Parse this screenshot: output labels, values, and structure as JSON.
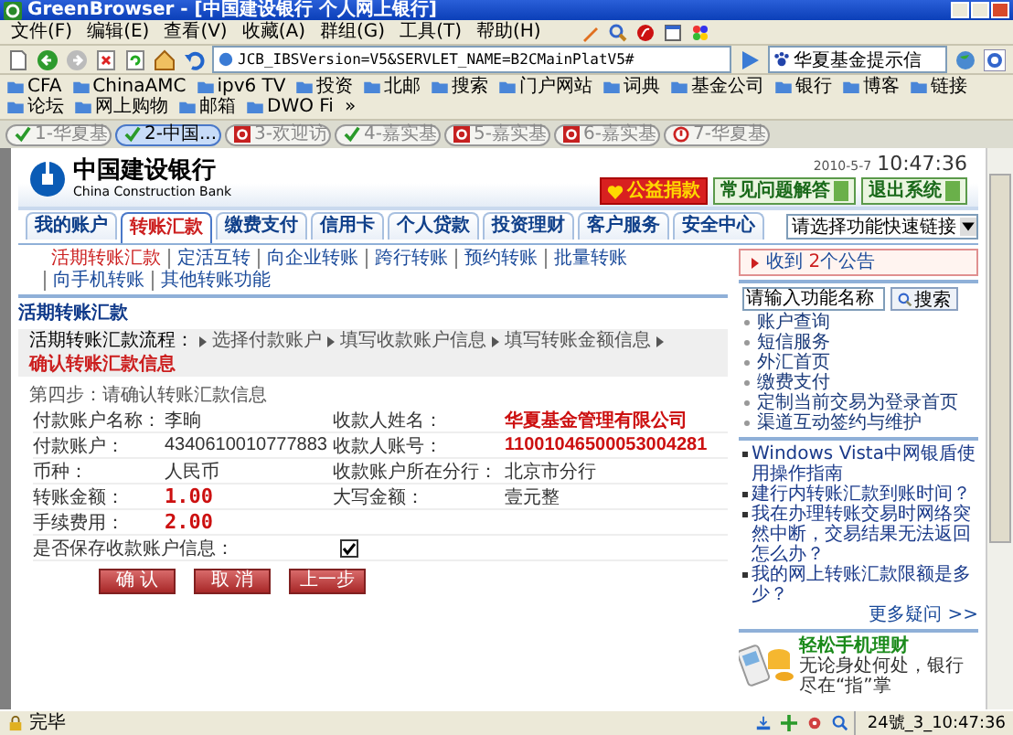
{
  "window": {
    "title": "GreenBrowser - [中国建设银行 个人网上银行]"
  },
  "menu": [
    "文件(F)",
    "编辑(E)",
    "查看(V)",
    "收藏(A)",
    "群组(G)",
    "工具(T)",
    "帮助(H)"
  ],
  "address_bar": {
    "value": "JCB_IBSVersion=V5&SERVLET_NAME=B2CMainPlatV5#"
  },
  "search_box": {
    "value": "华夏基金提示信"
  },
  "bookmarks": [
    "CFA",
    "ChinaAMC",
    "ipv6 TV",
    "投资",
    "北邮",
    "搜索",
    "门户网站",
    "词典",
    "基金公司",
    "银行",
    "博客",
    "链接",
    "论坛",
    "网上购物",
    "邮箱",
    "DWO Fi"
  ],
  "bookmarks_more": "»",
  "browser_tabs": [
    {
      "label": "1-华夏基",
      "kind": "ok",
      "selected": false
    },
    {
      "label": "2-中国...",
      "kind": "ok",
      "selected": true
    },
    {
      "label": "3-欢迎访",
      "kind": "site",
      "selected": false
    },
    {
      "label": "4-嘉实基",
      "kind": "ok",
      "selected": false
    },
    {
      "label": "5-嘉实基",
      "kind": "site",
      "selected": false
    },
    {
      "label": "6-嘉实基",
      "kind": "site",
      "selected": false
    },
    {
      "label": "7-华夏基",
      "kind": "alert",
      "selected": false
    }
  ],
  "page": {
    "logo": {
      "name_cn": "中国建设银行",
      "name_en": "China Construction Bank"
    },
    "date": "2010-5-7",
    "time": "10:47:36",
    "header_buttons": [
      {
        "label": "公益捐款",
        "kind": "donate"
      },
      {
        "label": "常见问题解答",
        "kind": "help"
      },
      {
        "label": "退出系统",
        "kind": "exit"
      }
    ],
    "nav_tabs": [
      {
        "label": "我的账户",
        "selected": false
      },
      {
        "label": "转账汇款",
        "selected": true
      },
      {
        "label": "缴费支付",
        "selected": false
      },
      {
        "label": "信用卡",
        "selected": false
      },
      {
        "label": "个人贷款",
        "selected": false
      },
      {
        "label": "投资理财",
        "selected": false
      },
      {
        "label": "客户服务",
        "selected": false
      },
      {
        "label": "安全中心",
        "selected": false
      }
    ],
    "quick_link": {
      "value": "请选择功能快速链接"
    },
    "sub_links": [
      {
        "label": "活期转账汇款",
        "selected": true
      },
      {
        "label": "定活互转",
        "selected": false
      },
      {
        "label": "向企业转账",
        "selected": false
      },
      {
        "label": "跨行转账",
        "selected": false
      },
      {
        "label": "预约转账",
        "selected": false
      },
      {
        "label": "批量转账",
        "selected": false
      },
      {
        "label": "向手机转账",
        "selected": false
      },
      {
        "label": "其他转账功能",
        "selected": false
      }
    ],
    "section_title": "活期转账汇款",
    "flow": {
      "label": "活期转账汇款流程：",
      "steps": [
        {
          "label": "选择付款账户",
          "selected": false
        },
        {
          "label": "填写收款账户信息",
          "selected": false
        },
        {
          "label": "填写转账金额信息",
          "selected": false
        },
        {
          "label": "确认转账汇款信息",
          "selected": true
        }
      ]
    },
    "step_hint": "第四步：请确认转账汇款信息",
    "rows": [
      {
        "cells": [
          {
            "label": "付款账户名称：",
            "value": "李晌",
            "kind": "text"
          },
          {
            "label": "收款人姓名：",
            "value": "华夏基金管理有限公司",
            "kind": "highlight"
          }
        ]
      },
      {
        "cells": [
          {
            "label": "付款账户：",
            "value": "4340610010777883",
            "kind": "text"
          },
          {
            "label": "收款人账号：",
            "value": "11001046500053004281",
            "kind": "highlight"
          }
        ]
      },
      {
        "cells": [
          {
            "label": "币种：",
            "value": "人民币",
            "kind": "text"
          },
          {
            "label": "收款账户所在分行：",
            "value": "北京市分行",
            "kind": "text"
          }
        ]
      },
      {
        "cells": [
          {
            "label": "转账金额：",
            "value": "1.00",
            "kind": "amount"
          },
          {
            "label": "大写金额：",
            "value": "壹元整",
            "kind": "text"
          }
        ]
      },
      {
        "cells": [
          {
            "label": "手续费用：",
            "value": "2.00",
            "kind": "amount"
          }
        ]
      }
    ],
    "save_info": {
      "label": "是否保存收款账户信息：",
      "checked": true
    },
    "buttons": [
      "确 认",
      "取 消",
      "上一步"
    ],
    "notice": {
      "prefix": "收到",
      "count": "2",
      "suffix": "个公告"
    },
    "sidebar": {
      "search": {
        "placeholder": "请输入功能名称",
        "button": "搜索"
      },
      "links": [
        "账户查询",
        "短信服务",
        "外汇首页",
        "缴费支付",
        "定制当前交易为登录首页",
        "渠道互动签约与维护"
      ],
      "questions": [
        "Windows Vista中网银盾使用操作指南",
        "建行内转账汇款到账时间？",
        "我在办理转账交易时网络突然中断，交易结果无法返回怎么办？",
        "我的网上转账汇款限额是多少？"
      ],
      "more": "更多疑问 >>",
      "ad": {
        "title": "轻松手机理财",
        "text": "无论身处何处，银行尽在“指”掌"
      }
    }
  },
  "status_bar": {
    "text": "完毕",
    "clock": "24號_3_10:47:36"
  }
}
